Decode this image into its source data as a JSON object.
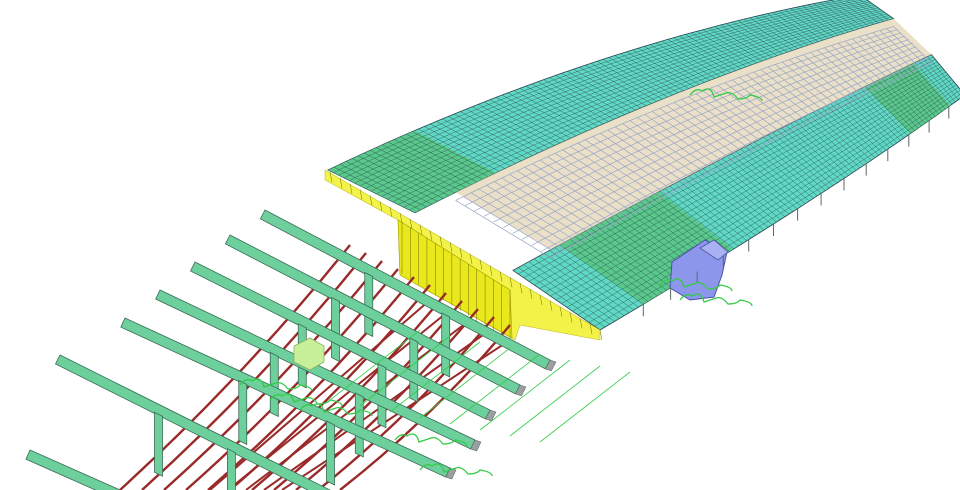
{
  "scene": {
    "description_visible_text": "",
    "colors": {
      "background": "#ffffff",
      "deck_mesh_fill": "#5fd9c4",
      "deck_mesh_lines": "#2e4a56",
      "deck_mesh_highlight": "#58c98a",
      "inner_girder_mesh": "#9aa6c8",
      "inner_deck_fill": "#d9c79a",
      "yellow_rebar": "#f2f02a",
      "green_diaphragm": "#6ccf9c",
      "diaphragm_outline": "#3b6b56",
      "tendon_red": "#9a2a2a",
      "tendon_green": "#33cc44",
      "bearing_blue": "#8c96ea",
      "small_block": "#c8f09a",
      "support_post": "#5a6a6a"
    },
    "icons": [
      "bridge-deck-mesh",
      "diaphragm-frame",
      "prestress-tendon",
      "bearing-pad"
    ]
  }
}
